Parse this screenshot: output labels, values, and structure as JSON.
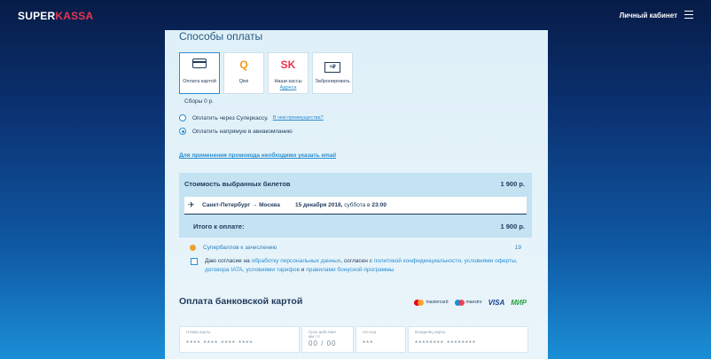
{
  "header": {
    "logo_part1": "SUPER",
    "logo_part2": "KASSA",
    "cabinet_label": "Личный кабинет"
  },
  "payment": {
    "title": "Способы оплаты",
    "methods": [
      {
        "label": "Оплата картой",
        "icon": "card-icon",
        "active": true
      },
      {
        "label": "Qiwi",
        "icon": "qiwi-icon",
        "active": false
      },
      {
        "label": "Наши кассы",
        "sublabel": "Адреса",
        "icon": "superkassa-icon",
        "icon_text": "SK",
        "active": false
      },
      {
        "label": "Забронировать",
        "icon": "booking-icon",
        "icon_text": "+₽",
        "active": false
      }
    ],
    "fees": "Сборы 0 р.",
    "options": [
      {
        "label": "Оплатить через Суперкассу.",
        "link": "В чем преимущества?",
        "selected": false
      },
      {
        "label": "Оплатить напрямую в авиакомпанию",
        "selected": true
      }
    ],
    "promo_link": "Для применения промокода необходимо указать email"
  },
  "summary": {
    "title": "Стоимость выбранных билетов",
    "price": "1 900 р.",
    "flight_route": "Санкт-Петербург → Москва",
    "flight_date": "15 декабря 2018,",
    "flight_weekday": "суббота в",
    "flight_time": "23:00",
    "total_label": "Итого к оплате:",
    "total_value": "1 900 р."
  },
  "bonus": {
    "label": "Супербаллов к зачислению",
    "value": "19"
  },
  "consent": {
    "t1": "Даю согласие на",
    "l1": "обработку персональных данных",
    "t2": ", согласен с",
    "l2": "политикой конфиденциальности, условиями оферты, договора IATA, условиями тарифов",
    "t3": "и",
    "l3": "правилами бонусной программы"
  },
  "card_payment": {
    "title": "Оплата банковской картой",
    "brands": {
      "mastercard": "mastercard",
      "maestro": "maestro",
      "visa": "VISA",
      "mir": "МИР"
    },
    "fields": [
      {
        "label": "Номер карты",
        "value": "**** **** **** ****"
      },
      {
        "label": "Срок действия\nмм / гг",
        "value": "00 / 00"
      },
      {
        "label": "cvc-код",
        "value": "***"
      },
      {
        "label": "Владелец карты",
        "value": "******** ********"
      }
    ]
  },
  "colors": {
    "accent": "#2a8ed1",
    "brand_red": "#e8344e",
    "mir_green": "#27a045",
    "visa_blue": "#1a3d8f"
  }
}
